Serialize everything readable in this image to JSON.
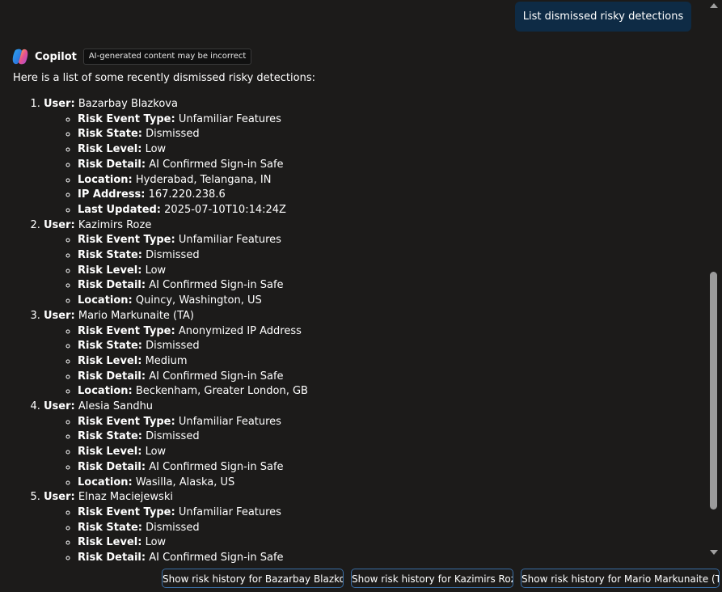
{
  "user_message": "List dismissed risky detections",
  "assistant": {
    "name": "Copilot",
    "badge": "AI-generated content may be incorrect",
    "intro": "Here is a list of some recently dismissed risky detections:"
  },
  "labels": {
    "user": "User:",
    "risk_event_type": "Risk Event Type:",
    "risk_state": "Risk State:",
    "risk_level": "Risk Level:",
    "risk_detail": "Risk Detail:",
    "location": "Location:",
    "ip_address": "IP Address:",
    "last_updated": "Last Updated:"
  },
  "detections": [
    {
      "user": "Bazarbay Blazkova",
      "risk_event_type": "Unfamiliar Features",
      "risk_state": "Dismissed",
      "risk_level": "Low",
      "risk_detail": "AI Confirmed Sign-in Safe",
      "location": "Hyderabad, Telangana, IN",
      "ip_address": "167.220.238.6",
      "last_updated": "2025-07-10T10:14:24Z"
    },
    {
      "user": "Kazimirs Roze",
      "risk_event_type": "Unfamiliar Features",
      "risk_state": "Dismissed",
      "risk_level": "Low",
      "risk_detail": "AI Confirmed Sign-in Safe",
      "location": "Quincy, Washington, US"
    },
    {
      "user": "Mario Markunaite (TA)",
      "risk_event_type": "Anonymized IP Address",
      "risk_state": "Dismissed",
      "risk_level": "Medium",
      "risk_detail": "AI Confirmed Sign-in Safe",
      "location": "Beckenham, Greater London, GB"
    },
    {
      "user": "Alesia Sandhu",
      "risk_event_type": "Unfamiliar Features",
      "risk_state": "Dismissed",
      "risk_level": "Low",
      "risk_detail": "AI Confirmed Sign-in Safe",
      "location": "Wasilla, Alaska, US"
    },
    {
      "user": "Elnaz Maciejewski",
      "risk_event_type": "Unfamiliar Features",
      "risk_state": "Dismissed",
      "risk_level": "Low",
      "risk_detail": "AI Confirmed Sign-in Safe"
    }
  ],
  "suggestions": [
    "Show risk history for Bazarbay Blazkova",
    "Show risk history for Kazimirs Roze",
    "Show risk history for Mario Markunaite (TA)"
  ],
  "colors": {
    "background": "#1c1b1a",
    "user_bubble": "#0e2b45",
    "chip_border": "#3a6ea5",
    "scroll_thumb": "#9b9b9b"
  },
  "icons": {
    "assistant_logo": "copilot-logo-icon",
    "scroll_up": "scroll-up-arrow-icon",
    "scroll_down": "scroll-down-arrow-icon"
  }
}
